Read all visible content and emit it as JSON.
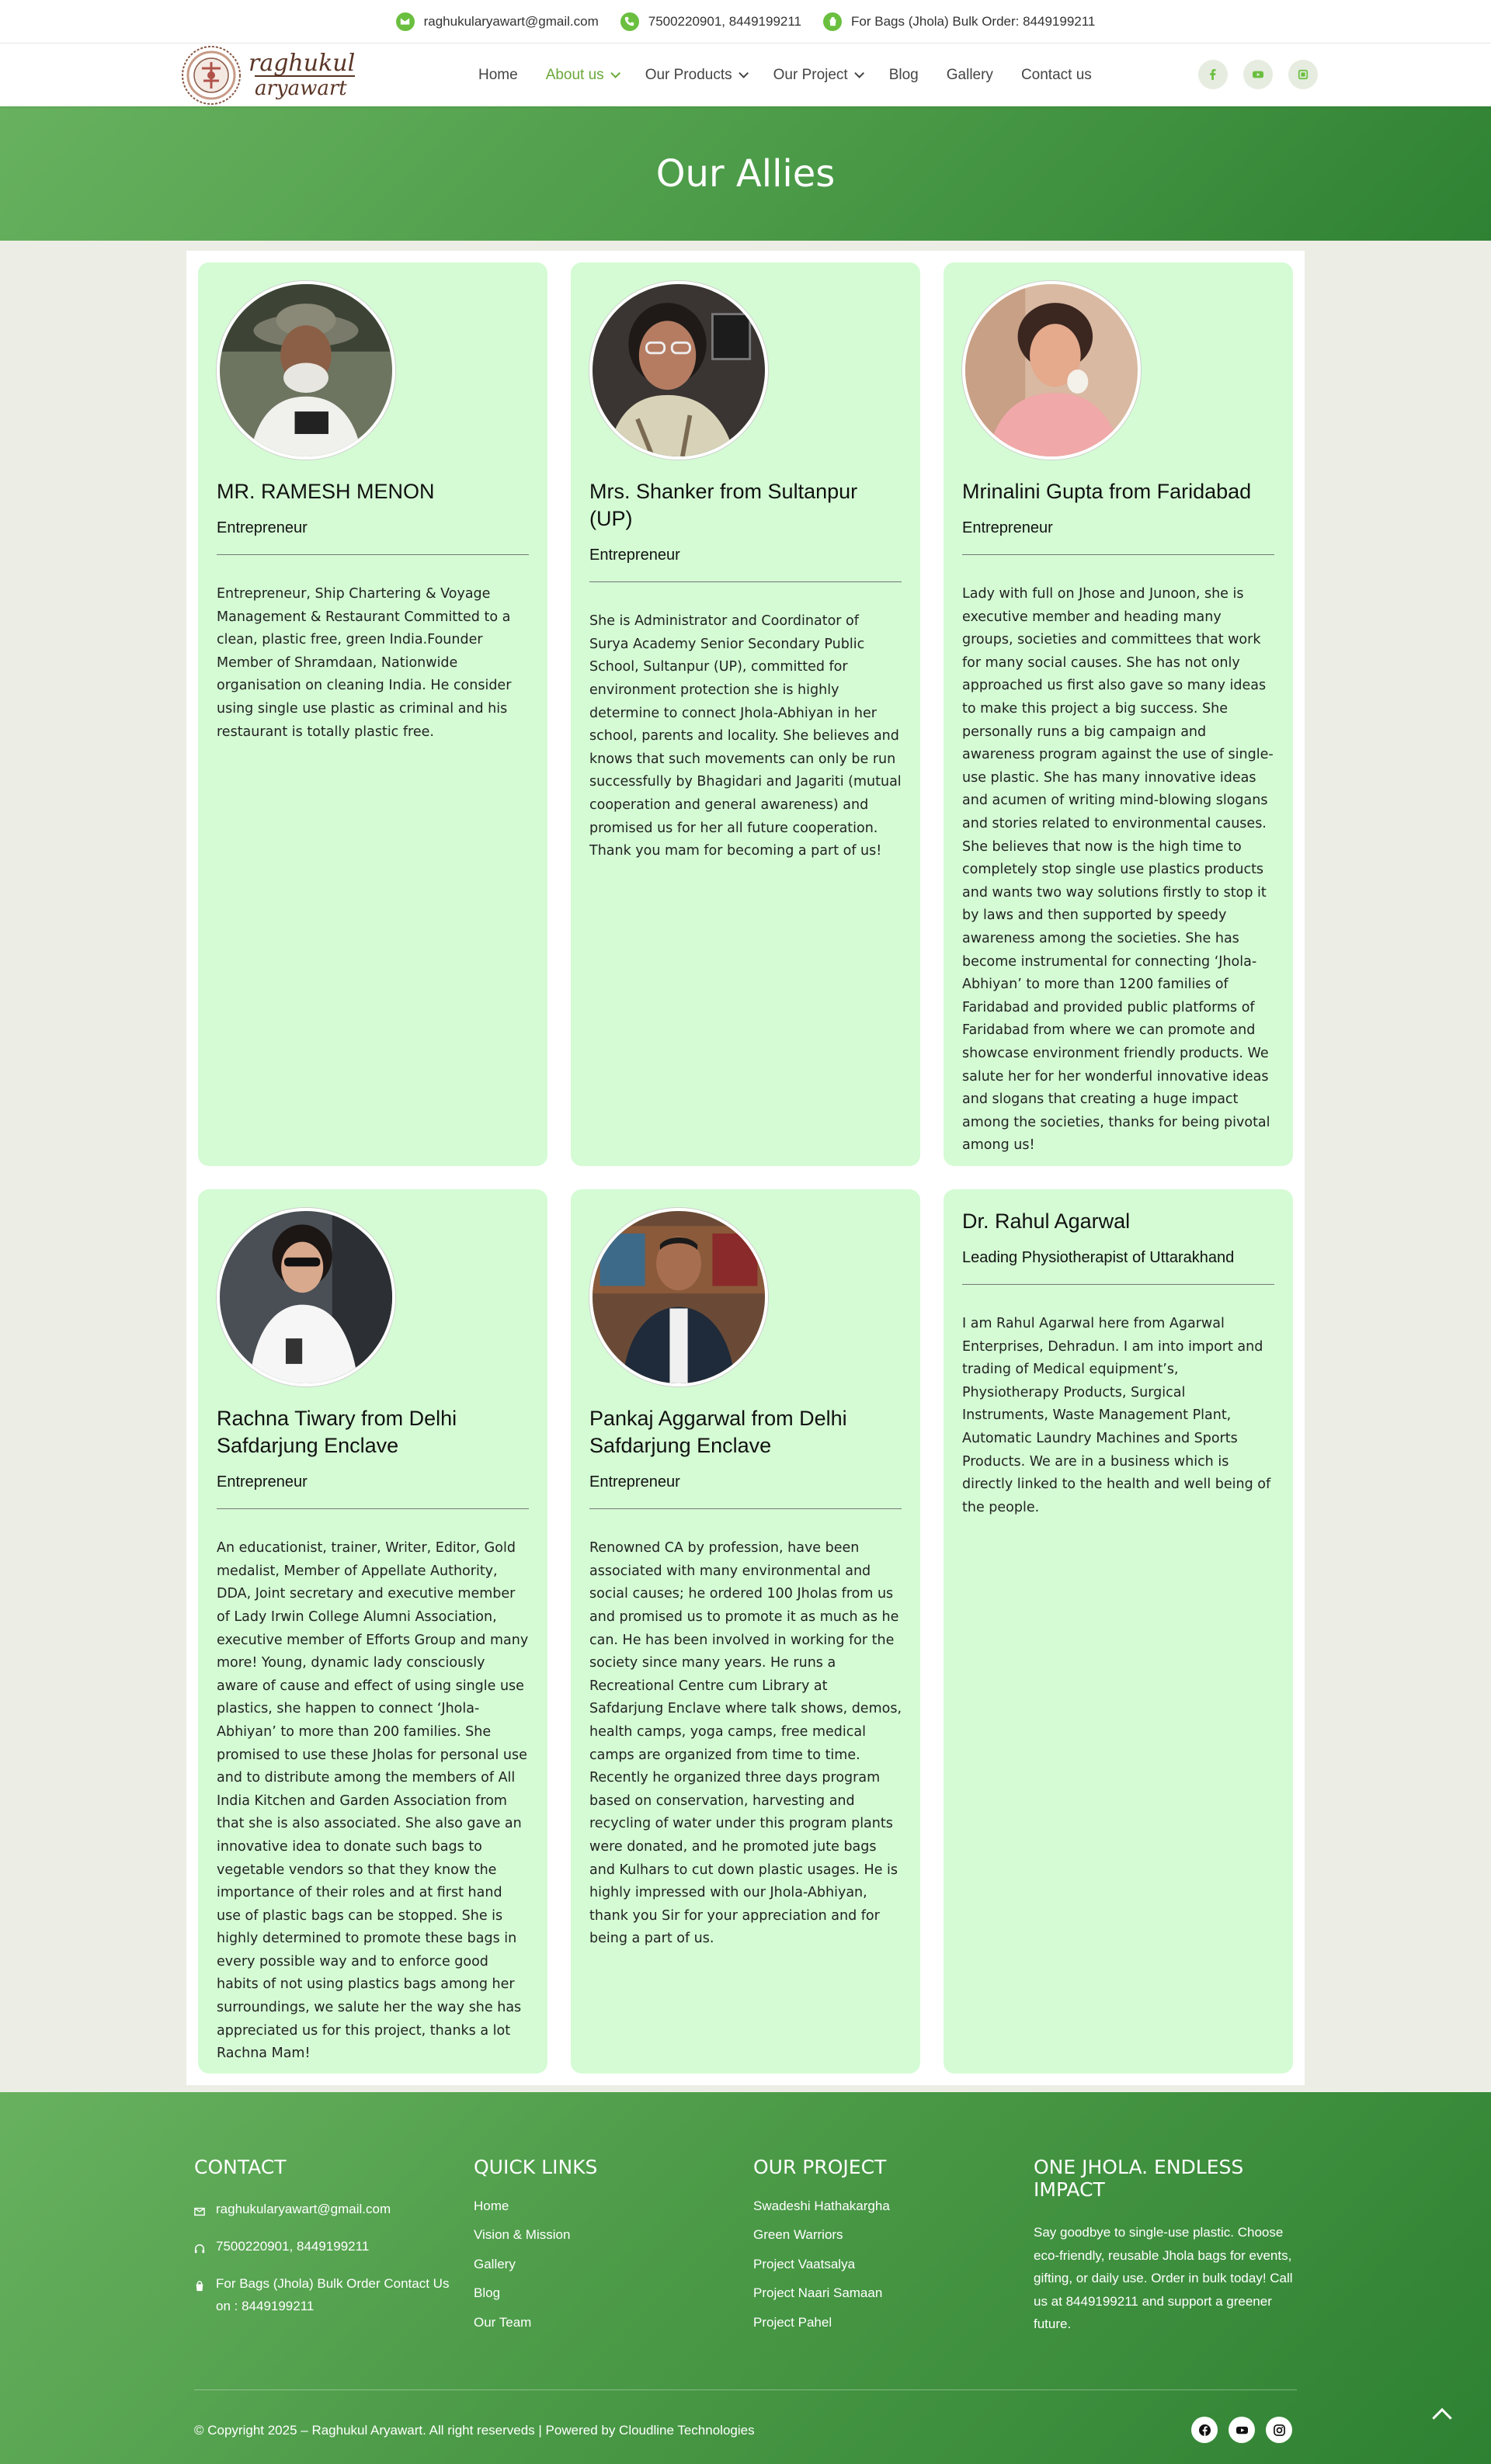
{
  "topbar": {
    "email": "raghukularyawart@gmail.com",
    "phone": "7500220901, 8449199211",
    "bulk": "For Bags (Jhola) Bulk Order: 8449199211"
  },
  "logo": {
    "line1": "raghukul",
    "line2": "aryawart"
  },
  "nav": {
    "items": [
      {
        "label": "Home"
      },
      {
        "label": "About us"
      },
      {
        "label": "Our Products"
      },
      {
        "label": "Our Project"
      },
      {
        "label": "Blog"
      },
      {
        "label": "Gallery"
      },
      {
        "label": "Contact us"
      }
    ]
  },
  "hero": {
    "title": "Our Allies"
  },
  "allies": [
    {
      "name": "MR. RAMESH MENON",
      "role": "Entrepreneur",
      "desc": "Entrepreneur, Ship Chartering & Voyage Management & Restaurant Committed to a clean, plastic free, green India.Founder Member of Shramdaan, Nationwide organisation on cleaning India. He consider using single use plastic as criminal and his restaurant is totally plastic free."
    },
    {
      "name": "Mrs. Shanker from Sultanpur (UP)",
      "role": "Entrepreneur",
      "desc": "She is Administrator and Coordinator of Surya Academy Senior Secondary Public School, Sultanpur (UP), committed for environment protection she is highly determine to connect Jhola-Abhiyan in her school, parents and locality. She believes and knows that such movements can only be run successfully by Bhagidari and Jagariti (mutual cooperation and general awareness) and promised us for her all future cooperation. Thank you mam for becoming a part of us!"
    },
    {
      "name": "Mrinalini Gupta from Faridabad",
      "role": "Entrepreneur",
      "desc": "Lady with full on Jhose and Junoon, she is executive member and heading many groups, societies and committees that work for many social causes. She has not only approached us first also gave so many ideas to make this project a big success. She personally runs a big campaign and awareness program against the use of single-use plastic. She has many innovative ideas and acumen of writing mind-blowing slogans and stories related to environmental causes. She believes that now is the high time to completely stop single use plastics products and wants two way solutions firstly to stop it by laws and then supported by speedy awareness among the societies. She has become instrumental for connecting ‘Jhola-Abhiyan’ to more than 1200 families of Faridabad and provided public platforms of Faridabad from where we can promote and showcase environment friendly products. We salute her for her wonderful innovative ideas and slogans that creating a huge impact among the societies, thanks for being pivotal among us!"
    },
    {
      "name": "Rachna Tiwary from Delhi Safdarjung Enclave",
      "role": "Entrepreneur",
      "desc": "An educationist, trainer, Writer, Editor, Gold medalist, Member of Appellate Authority, DDA, Joint secretary and executive member of Lady Irwin College Alumni Association, executive member of Efforts Group and many more! Young, dynamic lady consciously aware of cause and effect of using single use plastics, she happen to connect ‘Jhola-Abhiyan’ to more than 200 families. She promised to use these Jholas for personal use and to distribute among the members of All India Kitchen and Garden Association from that she is also associated. She also gave an innovative idea to donate such bags to vegetable vendors so that they know the importance of their roles and at first hand use of plastic bags can be stopped. She is highly determined to promote these bags in every possible way and to enforce good habits of not using plastics bags among her surroundings, we salute her the way she has appreciated us for this project, thanks a lot Rachna Mam!"
    },
    {
      "name": "Pankaj Aggarwal from Delhi Safdarjung Enclave",
      "role": "Entrepreneur",
      "desc": "Renowned CA by profession, have been associated with many environmental and social causes; he ordered 100 Jholas from us and promised us to promote it as much as he can. He has been involved in working for the society since many years. He runs a Recreational Centre cum Library at Safdarjung Enclave where talk shows, demos, health camps, yoga camps, free medical camps are organized from time to time. Recently he organized three days program based on conservation, harvesting and recycling of water under this program plants were donated, and he promoted jute bags and Kulhars to cut down plastic usages. He is highly impressed with our Jhola-Abhiyan, thank you Sir for your appreciation and for being a part of us."
    },
    {
      "name": "Dr. Rahul Agarwal",
      "role": "Leading Physiotherapist of Uttarakhand",
      "desc": "I am Rahul Agarwal here from Agarwal Enterprises, Dehradun. I am into import and trading of Medical equipment’s, Physiotherapy Products, Surgical Instruments, Waste Management Plant, Automatic Laundry Machines and Sports Products. We are in a business which is directly linked to the health and well being of the people."
    }
  ],
  "footer": {
    "contact": {
      "title": "CONTACT",
      "email": "raghukularyawart@gmail.com",
      "phone": "7500220901, 8449199211",
      "bulk": "For Bags (Jhola) Bulk Order Contact Us on : 8449199211"
    },
    "quick_links": {
      "title": "QUICK LINKS",
      "items": [
        "Home",
        "Vision & Mission",
        "Gallery",
        "Blog",
        "Our Team"
      ]
    },
    "project": {
      "title": "OUR PROJECT",
      "items": [
        "Swadeshi Hathakargha",
        "Green Warriors",
        "Project Vaatsalya",
        "Project Naari Samaan",
        "Project Pahel"
      ]
    },
    "impact": {
      "title": "ONE JHOLA. ENDLESS IMPACT",
      "text": "Say goodbye to single-use plastic. Choose eco-friendly, reusable Jhola bags for events, gifting, or daily use. Order in bulk today! Call us at 8449199211 and support a greener future."
    },
    "copyright": "© Copyright 2025 – Raghukul Aryawart. All right reserveds | Powered by Cloudline Technologies"
  },
  "colors": {
    "accent": "#6abf3f",
    "card_bg": "#d4fbd4",
    "hero_dark": "#2f8233",
    "hero_light": "#67b15f",
    "nav_active": "#6aa83a"
  }
}
